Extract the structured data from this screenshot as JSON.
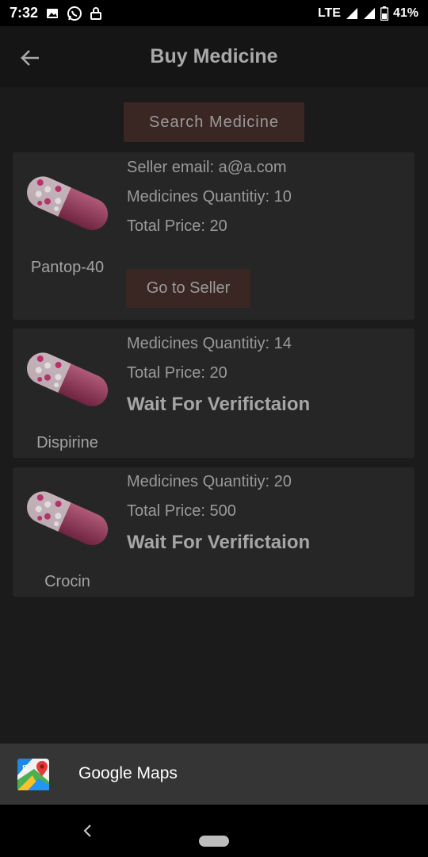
{
  "status_bar": {
    "time": "7:32",
    "network": "LTE",
    "battery": "41%",
    "icons": [
      "image-icon",
      "whatsapp-icon",
      "lock-icon",
      "wifi-signal-icon",
      "cell-signal-icon",
      "battery-icon"
    ]
  },
  "app_bar": {
    "title": "Buy Medicine",
    "back_icon": "arrow-left-icon"
  },
  "search_button": {
    "label": "Search Medicine"
  },
  "cards": [
    {
      "name": "Pantop-40",
      "seller_email": "Seller email: a@a.com",
      "quantity": "Medicines Quantitiy: 10",
      "total_price": "Total Price: 20",
      "action_label": "Go to Seller"
    },
    {
      "name": "Dispirine",
      "quantity": "Medicines Quantitiy: 14",
      "total_price": "Total Price: 20",
      "status": "Wait For Verifictaion"
    },
    {
      "name": "Crocin",
      "quantity": "Medicines Quantitiy: 20",
      "total_price": "Total Price: 500",
      "status": "Wait For Verifictaion"
    }
  ],
  "maps_sheet": {
    "label": "Google Maps",
    "icon": "google-maps-icon"
  },
  "nav_bar": {
    "back_icon": "nav-back-icon",
    "home_icon": "nav-home-pill"
  },
  "colors": {
    "background": "#1b1b1b",
    "card": "#262626",
    "button": "#3a2622",
    "text": "#9a9a9a"
  }
}
